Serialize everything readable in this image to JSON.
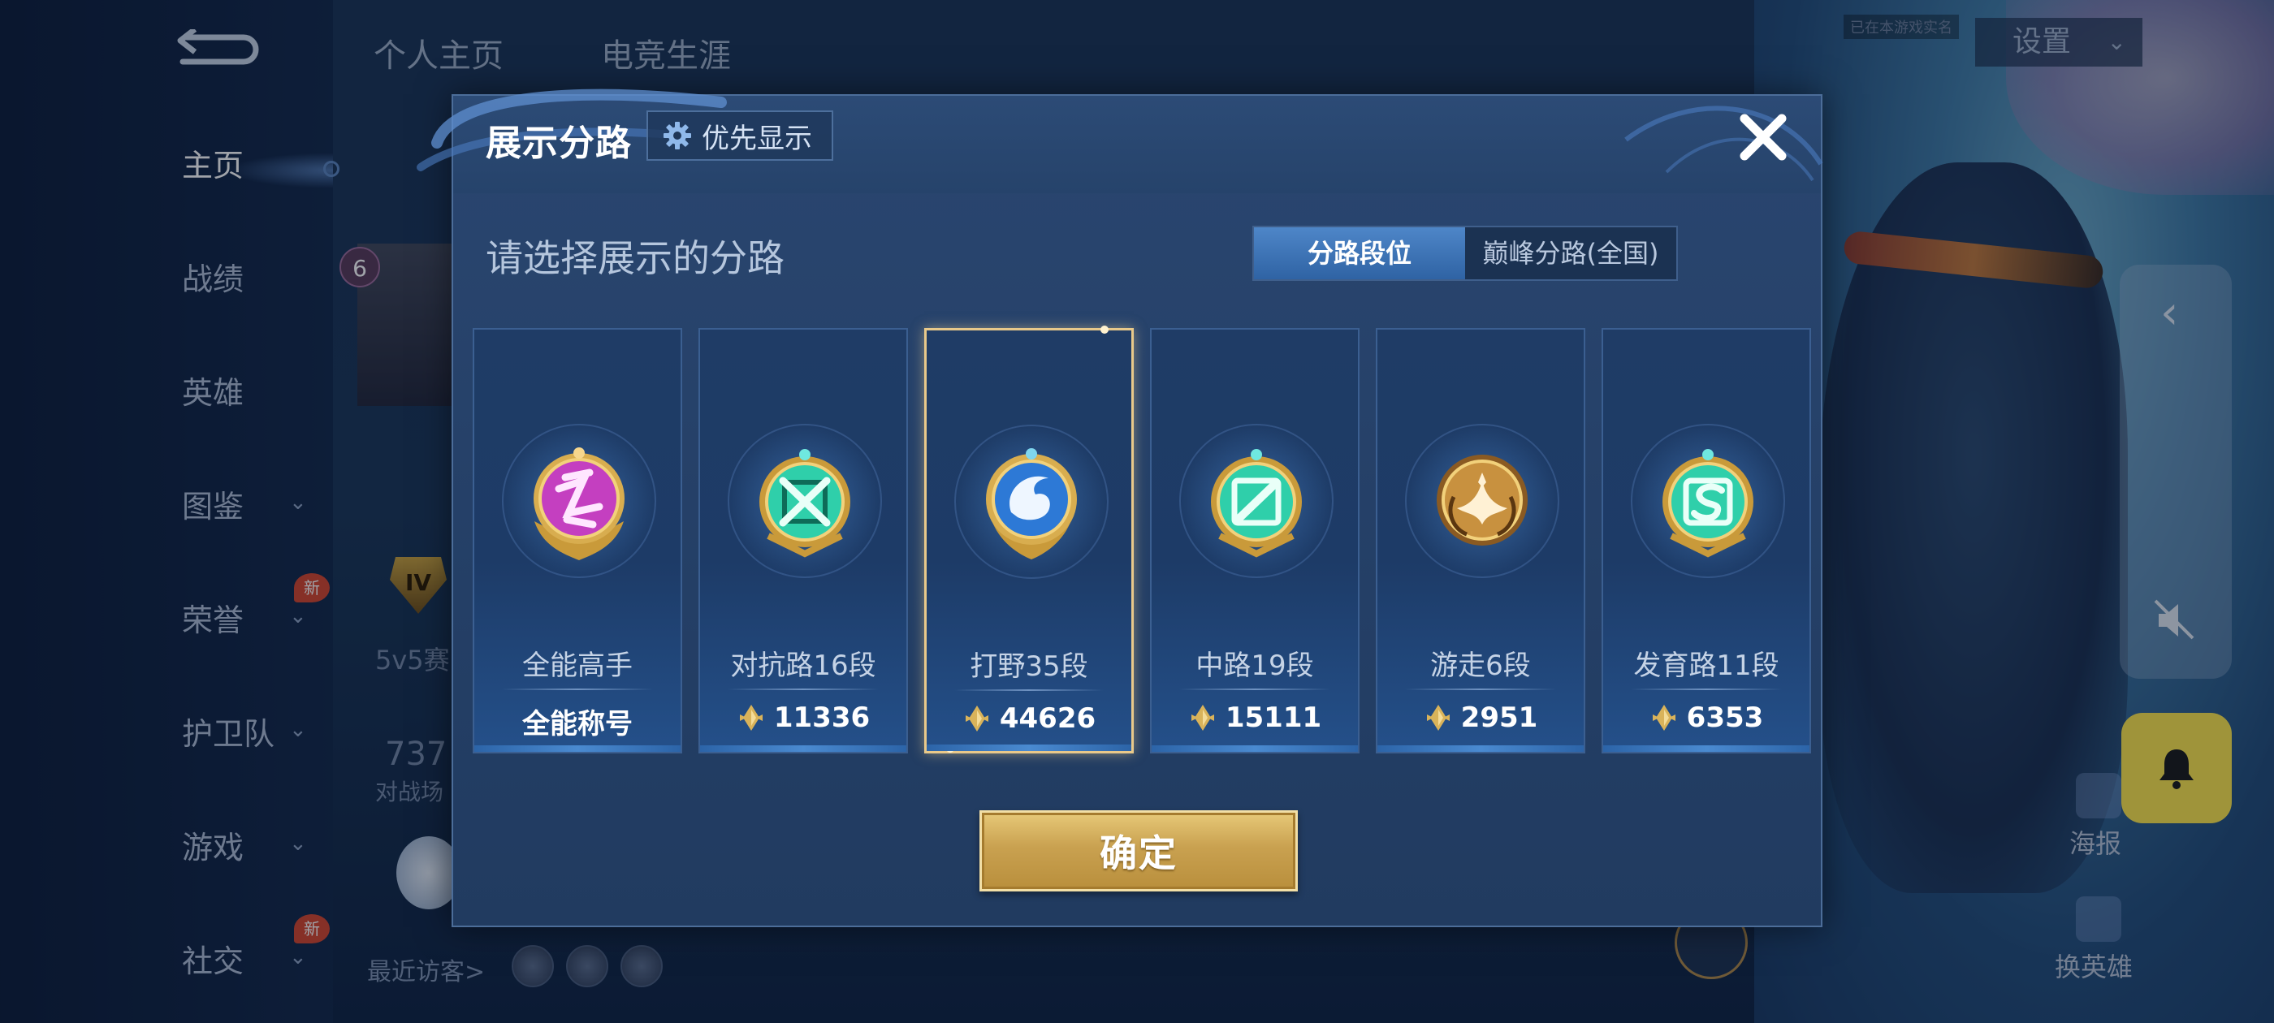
{
  "background": {
    "top_tabs": [
      "个人主页",
      "电竞生涯"
    ],
    "settings_label": "设置",
    "top_small_label": "已在本游戏实名",
    "nav_items": [
      {
        "label": "主页",
        "active": true,
        "has_chevron": false,
        "is_new": false
      },
      {
        "label": "战绩",
        "active": false,
        "has_chevron": false,
        "is_new": false
      },
      {
        "label": "英雄",
        "active": false,
        "has_chevron": false,
        "is_new": false
      },
      {
        "label": "图鉴",
        "active": false,
        "has_chevron": true,
        "is_new": false
      },
      {
        "label": "荣誉",
        "active": false,
        "has_chevron": true,
        "is_new": true
      },
      {
        "label": "护卫队",
        "active": false,
        "has_chevron": true,
        "is_new": false
      },
      {
        "label": "游戏",
        "active": false,
        "has_chevron": true,
        "is_new": false
      },
      {
        "label": "社交",
        "active": false,
        "has_chevron": true,
        "is_new": true
      }
    ],
    "new_badge": "新",
    "level_badge": "6",
    "rank_badge": "IV",
    "mode_text": "5v5赛",
    "stat_number": "737",
    "stat_label": "对战场",
    "recent_visitors": "最近访客>",
    "poster_label": "海报",
    "swap_hero_label": "换英雄"
  },
  "dialog": {
    "title": "展示分路",
    "priority_button": "优先显示",
    "subtitle": "请选择展示的分路",
    "segment": {
      "options": [
        "分路段位",
        "巅峰分路(全国)"
      ],
      "selected_index": 0
    },
    "cards": [
      {
        "name": "全能高手",
        "score": "全能称号",
        "score_icon": false,
        "emblem": "allround",
        "color": "#c43fc0",
        "selected": false
      },
      {
        "name": "对抗路16段",
        "score": "11336",
        "score_icon": true,
        "emblem": "clash",
        "color": "#2fcfaa",
        "selected": false
      },
      {
        "name": "打野35段",
        "score": "44626",
        "score_icon": true,
        "emblem": "jungle",
        "color": "#2d79d6",
        "selected": true
      },
      {
        "name": "中路19段",
        "score": "15111",
        "score_icon": true,
        "emblem": "mid",
        "color": "#2fcfaa",
        "selected": false
      },
      {
        "name": "游走6段",
        "score": "2951",
        "score_icon": true,
        "emblem": "roam",
        "color": "#c8913f",
        "selected": false
      },
      {
        "name": "发育路11段",
        "score": "6353",
        "score_icon": true,
        "emblem": "farm",
        "color": "#2fcfaa",
        "selected": false
      }
    ],
    "confirm_label": "确定"
  },
  "icons": {
    "close": "close-icon",
    "gear": "gear-icon",
    "score": "rank-point-icon",
    "bell": "bell-icon",
    "mute": "mute-icon",
    "back": "back-arrow-icon"
  },
  "colors": {
    "accent_blue": "#2f63a4",
    "confirm_gold": "#c9a150",
    "selection_gold": "#e9c98a",
    "bell_yellow": "#fde74c"
  }
}
